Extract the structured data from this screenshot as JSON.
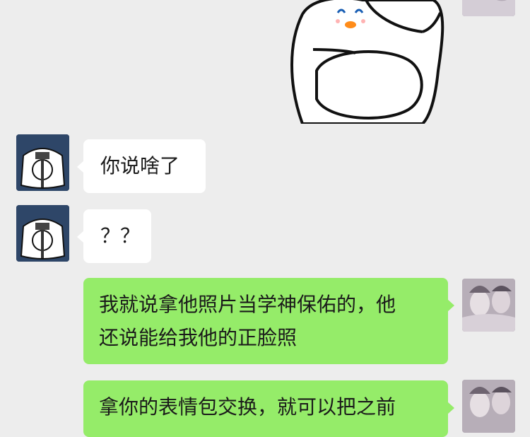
{
  "colors": {
    "background": "#ededed",
    "incoming_bubble": "#ffffff",
    "outgoing_bubble": "#95ec69",
    "text": "#1a1a1a"
  },
  "messages": [
    {
      "side": "right",
      "type": "sticker",
      "icon": "cartoon-blob-sticker"
    },
    {
      "side": "left",
      "type": "text",
      "text": "你说啥了"
    },
    {
      "side": "left",
      "type": "text",
      "text": "？？"
    },
    {
      "side": "right",
      "type": "text",
      "line1": "我就说拿他照片当学神保佑的，他",
      "line2": "还说能给我他的正脸照"
    },
    {
      "side": "right",
      "type": "text",
      "line1": "拿你的表情包交换，就可以把之前"
    }
  ]
}
